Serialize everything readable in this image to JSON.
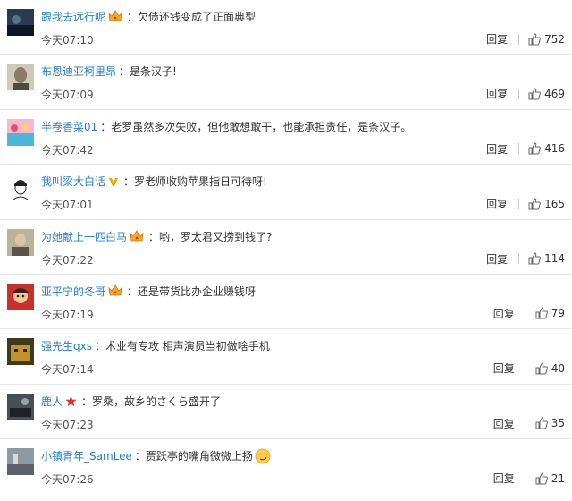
{
  "comments": [
    {
      "user": "跟我去远行呢",
      "badge": "crown-icon",
      "text": "：欠债还钱变成了正面典型",
      "time": "今天07:10",
      "reply": "回复",
      "likes": "752"
    },
    {
      "user": "布恩迪亚柯里昂",
      "badge": "",
      "text": "：是条汉子!",
      "time": "今天07:09",
      "reply": "回复",
      "likes": "469"
    },
    {
      "user": "半卷香菜01",
      "badge": "",
      "text": "：老罗虽然多次失败，但他敢想敢干，也能承担责任，是条汉子。",
      "time": "今天07:42",
      "reply": "回复",
      "likes": "416"
    },
    {
      "user": "我叫梁大白话",
      "badge": "verified-v-icon",
      "text": "：罗老师收购苹果指日可待呀!",
      "time": "今天07:01",
      "reply": "回复",
      "likes": "165"
    },
    {
      "user": "为她献上一匹白马",
      "badge": "crown-icon",
      "text": "：哟，罗太君又捞到钱了?",
      "time": "今天07:22",
      "reply": "回复",
      "likes": "114"
    },
    {
      "user": "亚平宁的冬哥",
      "badge": "crown-icon",
      "text": "：还是带货比办企业赚钱呀",
      "time": "今天07:19",
      "reply": "回复",
      "likes": "79"
    },
    {
      "user": "强先生qxs",
      "badge": "",
      "text": "：术业有专攻 相声演员当初做啥手机",
      "time": "今天07:14",
      "reply": "回复",
      "likes": "40"
    },
    {
      "user": "鹿人",
      "badge": "star-icon",
      "text": "：罗桑，故乡的さくら盛开了",
      "time": "今天07:23",
      "reply": "回复",
      "likes": "35"
    },
    {
      "user": "小镇青年_SamLee",
      "badge": "",
      "text": "：贾跃亭的嘴角微微上扬",
      "time": "今天07:26",
      "reply": "回复",
      "likes": "21",
      "emoji": "smirk-emoji-icon"
    }
  ],
  "colors": {
    "username": "#2a7ec6",
    "crown": "#f5a623",
    "star": "#e0322b",
    "verified": "#f2a100"
  }
}
